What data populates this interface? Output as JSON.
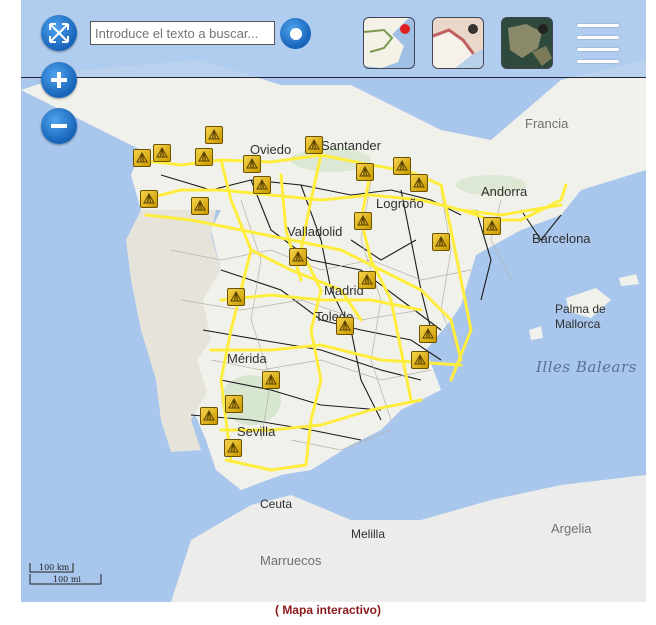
{
  "toolbar": {
    "search_placeholder": "Introduce el texto a buscar...",
    "buttons": {
      "fit": "arrows-expand-icon",
      "zoom_in": "plus-icon",
      "zoom_out": "minus-icon",
      "search": "search-circle-icon",
      "layer_map": "street-map-layer",
      "layer_terrain": "terrain-layer",
      "layer_satellite": "satellite-layer",
      "menu": "hamburger-menu-icon"
    }
  },
  "map": {
    "labels": {
      "francia": "Francia",
      "andorra": "Andorra",
      "barcelona": "Barcelona",
      "palma": "Palma de",
      "mallorca": "Mallorca",
      "illes_balears": "Illes Balears",
      "oviedo": "Oviedo",
      "santander": "Santander",
      "logrono": "Logroño",
      "valladolid": "Valladolid",
      "madrid": "Madrid",
      "toledo": "Toledo",
      "merida": "Mérida",
      "sevilla": "Sevilla",
      "ceuta": "Ceuta",
      "melilla": "Melilla",
      "marruecos": "Marruecos",
      "argelia": "Argelia"
    },
    "scale": {
      "km": "100 km",
      "mi": "100 mi"
    },
    "colors": {
      "sea": "#a9c6ec",
      "land": "#f2f2ee",
      "routes": "#ffee44",
      "marker": "#e2b400"
    }
  },
  "footer": {
    "caption": "( Mapa interactivo)"
  }
}
